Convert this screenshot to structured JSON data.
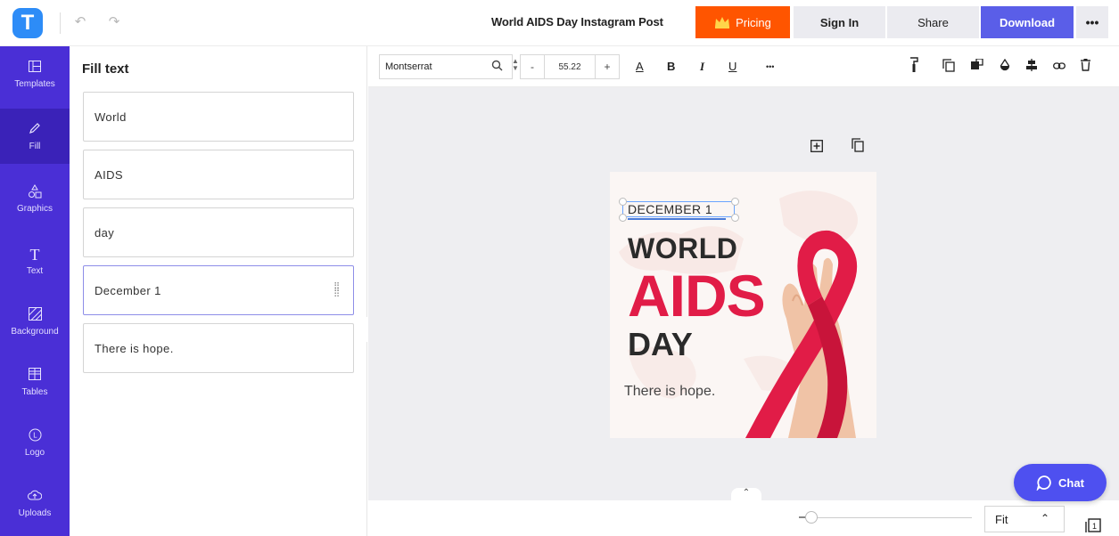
{
  "app": {
    "logo_letter": "T"
  },
  "header": {
    "undo_icon": "↶",
    "redo_icon": "↷",
    "doc_title": "World AIDS Day Instagram Post",
    "pricing_label": "Pricing",
    "signin_label": "Sign In",
    "share_label": "Share",
    "download_label": "Download",
    "more_label": "•••"
  },
  "colors": {
    "nav_bg": "#4a2fd6",
    "pricing": "#ff5500",
    "download": "#5a5ee8",
    "accent_red": "#e11c47"
  },
  "sidebar": {
    "items": [
      {
        "label": "Templates",
        "icon": "templates-icon"
      },
      {
        "label": "Fill",
        "icon": "pencil-icon"
      },
      {
        "label": "Graphics",
        "icon": "shapes-icon"
      },
      {
        "label": "Text",
        "icon": "text-icon"
      },
      {
        "label": "Background",
        "icon": "background-icon"
      },
      {
        "label": "Tables",
        "icon": "table-icon"
      },
      {
        "label": "Logo",
        "icon": "logo-icon"
      },
      {
        "label": "Uploads",
        "icon": "upload-cloud-icon"
      }
    ]
  },
  "panel": {
    "title": "Fill text",
    "fields": [
      "World",
      "AIDS",
      "day",
      "December 1",
      "There is hope."
    ]
  },
  "toolbar": {
    "font_name": "Montserrat",
    "minus": "-",
    "font_size": "55.22",
    "plus": "+",
    "bold": "B",
    "italic": "I",
    "underline": "U",
    "text_color": "A",
    "more": "•••"
  },
  "artboard": {
    "date_text": "DECEMBER 1",
    "world_text": "WORLD",
    "aids_text": "AIDS",
    "day_text": "DAY",
    "hope_text": "There is hope."
  },
  "bottom": {
    "zoom_label": "Fit",
    "chat_label": "Chat"
  }
}
